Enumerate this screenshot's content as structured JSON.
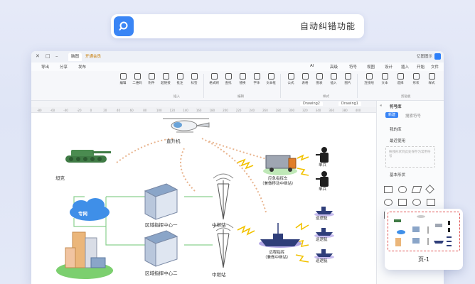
{
  "search": {
    "text": "自动纠错功能"
  },
  "titlebar": {
    "logo_text": "亿图图示",
    "tab_label": "脑图",
    "tab_label_2": "开通会员",
    "right_labels": [
      "分享",
      "发布",
      "导出"
    ]
  },
  "menubar": {
    "items": [
      "文件",
      "开始",
      "插入",
      "设计",
      "视图",
      "符号",
      "高级",
      "AI"
    ]
  },
  "ribbon": {
    "items": [
      "选择",
      "文本",
      "连接线",
      "图片",
      "插入",
      "图表",
      "表格",
      "公式",
      "大纲",
      "形状",
      "样式",
      "字体",
      "文本框",
      "布局",
      "对齐",
      "组合",
      "大小",
      "旋转",
      "锁定",
      "替换",
      "查找",
      "格式刷",
      "排版",
      "清除",
      "描述",
      "文本",
      "标签",
      "批注",
      "超链接",
      "附件",
      "二维码",
      "编辑"
    ],
    "groups": [
      "剪贴板",
      "字体",
      "段落",
      "排列",
      "样式",
      "编辑",
      "插入"
    ]
  },
  "doctabs": {
    "tabs": [
      "Drawing1",
      "Drawing2"
    ]
  },
  "ruler": {
    "marks": [
      "-80",
      "-60",
      "-40",
      "-20",
      "0",
      "20",
      "40",
      "60",
      "80",
      "100",
      "120",
      "140",
      "160",
      "180",
      "200",
      "220",
      "240",
      "260",
      "280",
      "300",
      "320",
      "340",
      "360",
      "380",
      "400"
    ]
  },
  "diagram": {
    "helicopter": "直升机",
    "tank": "坦克",
    "cloud": "专网",
    "regional1": "区域指挥中心一",
    "regional2": "区域指挥中心二",
    "relay1": "中继站",
    "relay2": "中继站",
    "vehicle_line1": "应急指挥车",
    "vehicle_line2": "（兼做移动中继站）",
    "ship_line1": "远程指挥",
    "ship_line2": "（兼做中继站）",
    "soldier1": "单兵",
    "soldier2": "单兵",
    "boat1": "巡逻艇",
    "boat2": "巡逻艇",
    "boat3": "巡逻艇"
  },
  "sidepanel": {
    "title": "符号库",
    "btn_primary": "新建",
    "search_label": "搜索符号",
    "section1": "我的库",
    "section2": "最近使用",
    "empty_hint": "拖拽形状到此处保存为常用符号",
    "section3": "基本形状"
  },
  "thumbnail": {
    "page_label": "页-1"
  },
  "colors": {
    "accent": "#3a85f5",
    "tank": "#3f7b45",
    "building": "#8aa5c8",
    "cloud": "#3f8fe8",
    "ship": "#2f3e7a",
    "zigzag": "#f2c200",
    "dotted": "#e8b48e"
  }
}
